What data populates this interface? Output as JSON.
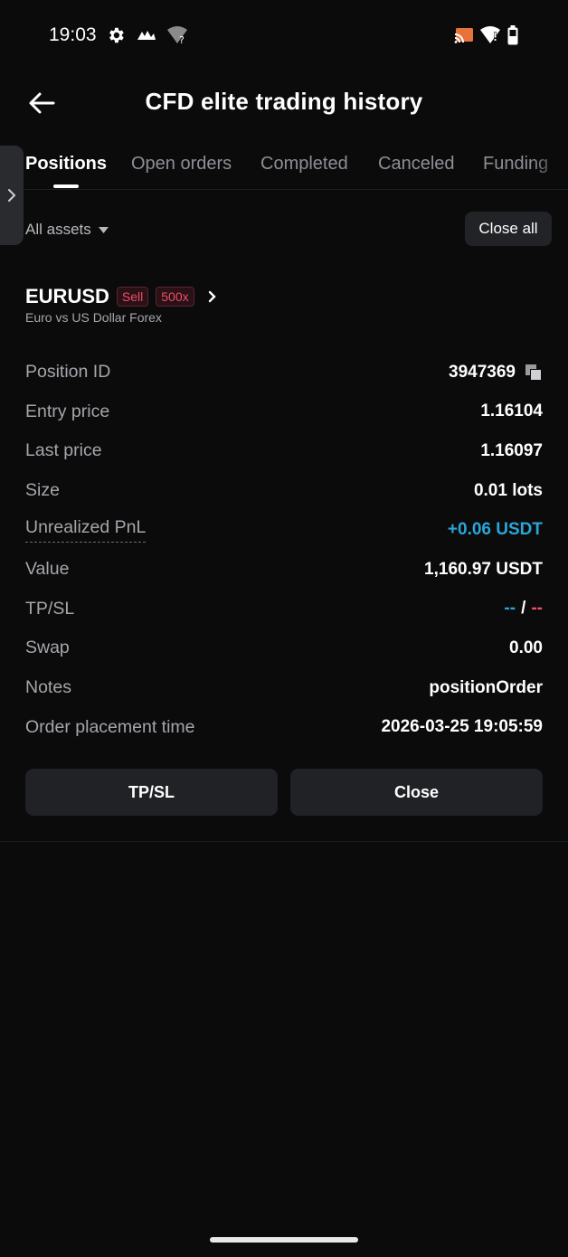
{
  "status_bar": {
    "time": "19:03",
    "icons": [
      "settings-icon",
      "app-notification-icon",
      "wifi-unknown-icon",
      "cast-icon",
      "wifi-alert-icon",
      "battery-icon"
    ]
  },
  "header": {
    "title": "CFD elite trading history",
    "back_icon": "arrow-left-icon"
  },
  "tabs": [
    {
      "label": "Positions",
      "active": true
    },
    {
      "label": "Open orders",
      "active": false
    },
    {
      "label": "Completed",
      "active": false
    },
    {
      "label": "Canceled",
      "active": false
    },
    {
      "label": "Funding",
      "active": false
    }
  ],
  "filter": {
    "label": "All assets",
    "close_all_label": "Close all"
  },
  "position": {
    "symbol": "EURUSD",
    "side_badge": "Sell",
    "leverage_badge": "500x",
    "subtitle": "Euro vs US Dollar  Forex",
    "rows": [
      {
        "label": "Position ID",
        "value": "3947369"
      },
      {
        "label": "Entry price",
        "value": "1.16104"
      },
      {
        "label": "Last price",
        "value": "1.16097"
      },
      {
        "label": "Size",
        "value": "0.01 lots"
      },
      {
        "label": "Unrealized PnL",
        "value": "+0.06 USDT"
      },
      {
        "label": "Value",
        "value": "1,160.97 USDT"
      },
      {
        "label": "TP/SL",
        "tp": "--",
        "sep": "/",
        "sl": "--"
      },
      {
        "label": "Swap",
        "value": "0.00"
      },
      {
        "label": "Notes",
        "value": "positionOrder"
      },
      {
        "label": "Order placement time",
        "value": "2026-03-25 19:05:59"
      }
    ],
    "buttons": {
      "tpsl": "TP/SL",
      "close": "Close"
    }
  },
  "colors": {
    "background": "#0b0b0c",
    "positive": "#2ba6d8",
    "negative": "#ef4d6a",
    "button_bg": "#212225"
  }
}
